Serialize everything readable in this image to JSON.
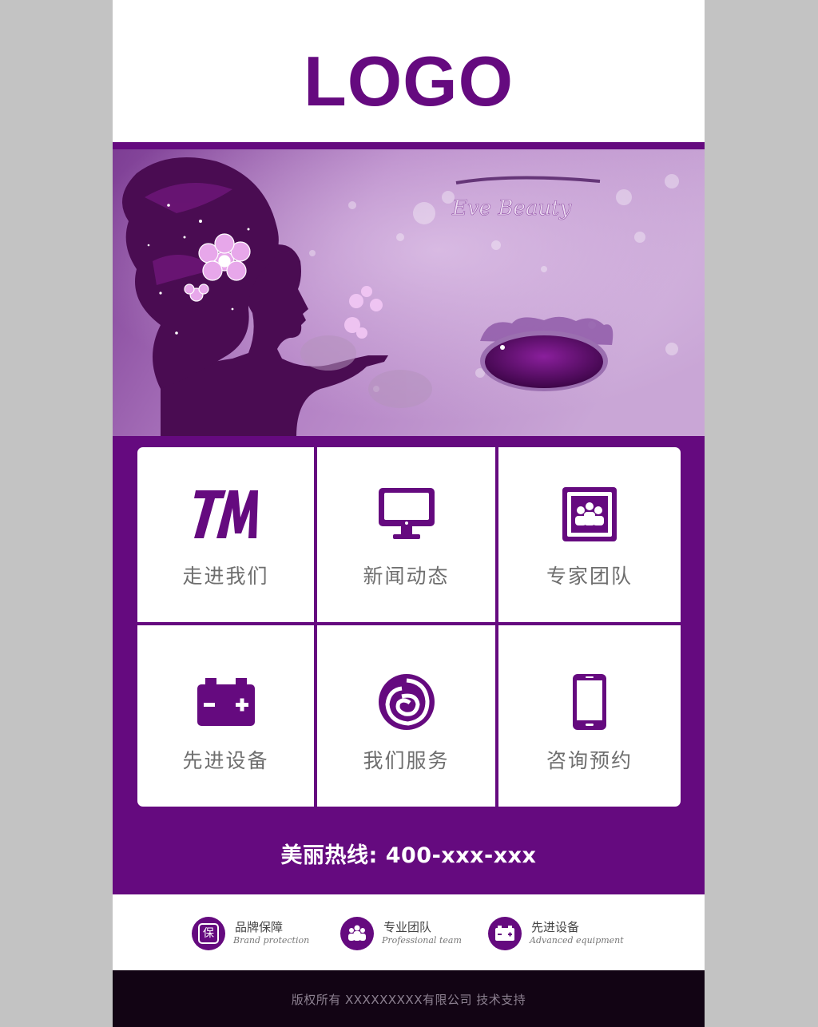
{
  "colors": {
    "brand": "#650a7f",
    "brand_dark": "#4f075f",
    "footer_bg": "#120414",
    "outer_bg": "#c3c3c3"
  },
  "header": {
    "logo": "LOGO"
  },
  "banner": {
    "script_text": "Eve Beauty"
  },
  "grid": [
    {
      "label": "走进我们",
      "icon": "tm-logo-icon"
    },
    {
      "label": "新闻动态",
      "icon": "monitor-icon"
    },
    {
      "label": "专家团队",
      "icon": "team-photo-icon"
    },
    {
      "label": "先进设备",
      "icon": "battery-icon"
    },
    {
      "label": "我们服务",
      "icon": "rose-icon"
    },
    {
      "label": "咨询预约",
      "icon": "smartphone-icon"
    }
  ],
  "hotline": "美丽热线: 400-xxx-xxx",
  "features": [
    {
      "title": "品牌保障",
      "subtitle": "Brand protection",
      "icon": "shield-bao-icon",
      "glyph": "保"
    },
    {
      "title": "专业团队",
      "subtitle": "Professional team",
      "icon": "team-people-icon"
    },
    {
      "title": "先进设备",
      "subtitle": "Advanced equipment",
      "icon": "battery-icon"
    }
  ],
  "footer": {
    "text": "版权所有   XXXXXXXXX有限公司 技术支持"
  }
}
